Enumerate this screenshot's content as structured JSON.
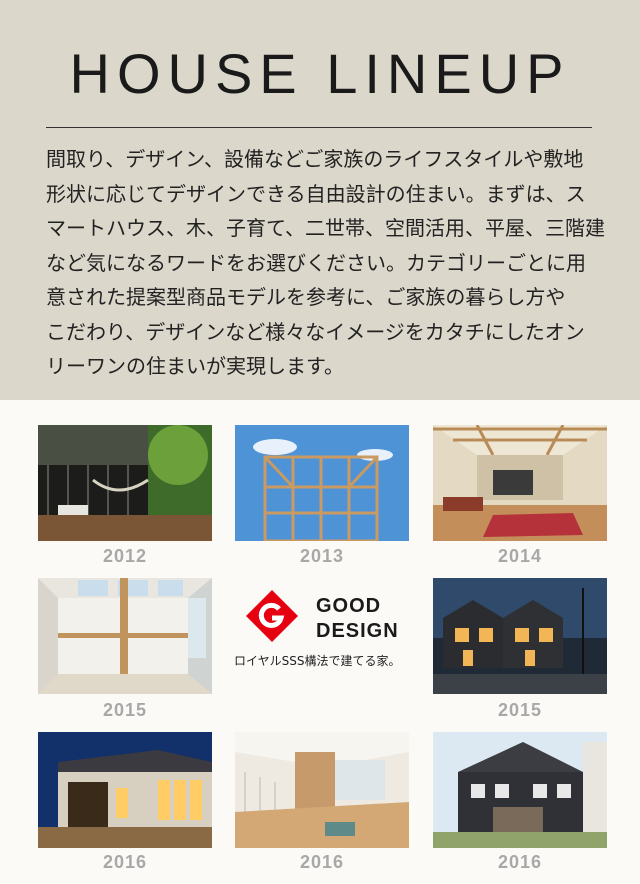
{
  "title": "HOUSE LINEUP",
  "intro_lines": [
    "間取り、デザイン、設備などご家族のライフスタイルや敷地",
    "形状に応じてデザインできる自由設計の住まい。まずは、ス",
    "マートハウス、木、子育て、二世帯、空間活用、平屋、三階建",
    "など気になるワードをお選びください。カテゴリーごとに用",
    "意された提案型商品モデルを参考に、ご家族の暮らし方や",
    "こだわり、デザインなど様々なイメージをカタチにしたオン",
    "リーワンの住まいが実現します。"
  ],
  "gallery": [
    {
      "year": "2012"
    },
    {
      "year": "2013"
    },
    {
      "year": "2014"
    },
    {
      "year": "2015"
    },
    {
      "year": "2015"
    },
    {
      "year": "2016"
    },
    {
      "year": "2016"
    },
    {
      "year": "2016"
    }
  ],
  "good_design": {
    "line1": "GOOD",
    "line2": "DESIGN",
    "caption": "ロイヤルSSS構法で建てる家。",
    "mark_color": "#e60012"
  }
}
